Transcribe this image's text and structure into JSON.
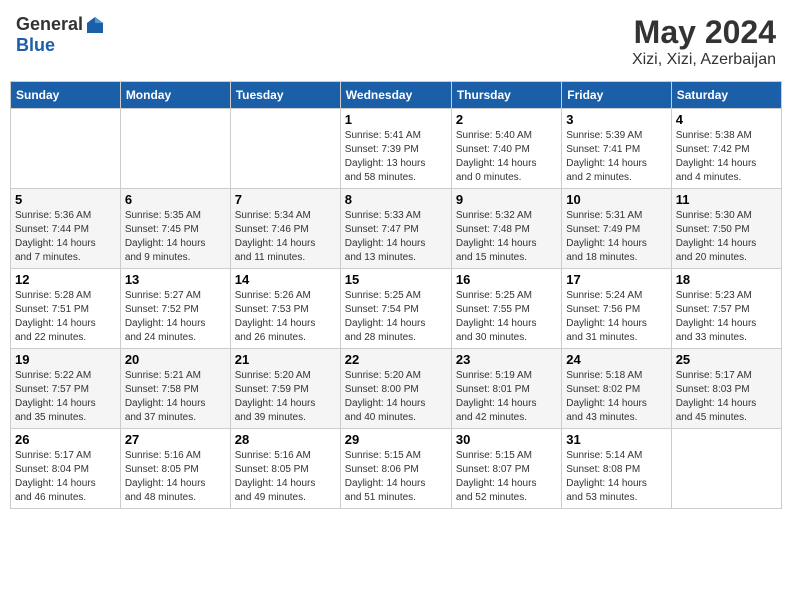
{
  "header": {
    "logo_general": "General",
    "logo_blue": "Blue",
    "month_title": "May 2024",
    "location": "Xizi, Xizi, Azerbaijan"
  },
  "weekdays": [
    "Sunday",
    "Monday",
    "Tuesday",
    "Wednesday",
    "Thursday",
    "Friday",
    "Saturday"
  ],
  "weeks": [
    [
      {
        "day": "",
        "info": ""
      },
      {
        "day": "",
        "info": ""
      },
      {
        "day": "",
        "info": ""
      },
      {
        "day": "1",
        "info": "Sunrise: 5:41 AM\nSunset: 7:39 PM\nDaylight: 13 hours\nand 58 minutes."
      },
      {
        "day": "2",
        "info": "Sunrise: 5:40 AM\nSunset: 7:40 PM\nDaylight: 14 hours\nand 0 minutes."
      },
      {
        "day": "3",
        "info": "Sunrise: 5:39 AM\nSunset: 7:41 PM\nDaylight: 14 hours\nand 2 minutes."
      },
      {
        "day": "4",
        "info": "Sunrise: 5:38 AM\nSunset: 7:42 PM\nDaylight: 14 hours\nand 4 minutes."
      }
    ],
    [
      {
        "day": "5",
        "info": "Sunrise: 5:36 AM\nSunset: 7:44 PM\nDaylight: 14 hours\nand 7 minutes."
      },
      {
        "day": "6",
        "info": "Sunrise: 5:35 AM\nSunset: 7:45 PM\nDaylight: 14 hours\nand 9 minutes."
      },
      {
        "day": "7",
        "info": "Sunrise: 5:34 AM\nSunset: 7:46 PM\nDaylight: 14 hours\nand 11 minutes."
      },
      {
        "day": "8",
        "info": "Sunrise: 5:33 AM\nSunset: 7:47 PM\nDaylight: 14 hours\nand 13 minutes."
      },
      {
        "day": "9",
        "info": "Sunrise: 5:32 AM\nSunset: 7:48 PM\nDaylight: 14 hours\nand 15 minutes."
      },
      {
        "day": "10",
        "info": "Sunrise: 5:31 AM\nSunset: 7:49 PM\nDaylight: 14 hours\nand 18 minutes."
      },
      {
        "day": "11",
        "info": "Sunrise: 5:30 AM\nSunset: 7:50 PM\nDaylight: 14 hours\nand 20 minutes."
      }
    ],
    [
      {
        "day": "12",
        "info": "Sunrise: 5:28 AM\nSunset: 7:51 PM\nDaylight: 14 hours\nand 22 minutes."
      },
      {
        "day": "13",
        "info": "Sunrise: 5:27 AM\nSunset: 7:52 PM\nDaylight: 14 hours\nand 24 minutes."
      },
      {
        "day": "14",
        "info": "Sunrise: 5:26 AM\nSunset: 7:53 PM\nDaylight: 14 hours\nand 26 minutes."
      },
      {
        "day": "15",
        "info": "Sunrise: 5:25 AM\nSunset: 7:54 PM\nDaylight: 14 hours\nand 28 minutes."
      },
      {
        "day": "16",
        "info": "Sunrise: 5:25 AM\nSunset: 7:55 PM\nDaylight: 14 hours\nand 30 minutes."
      },
      {
        "day": "17",
        "info": "Sunrise: 5:24 AM\nSunset: 7:56 PM\nDaylight: 14 hours\nand 31 minutes."
      },
      {
        "day": "18",
        "info": "Sunrise: 5:23 AM\nSunset: 7:57 PM\nDaylight: 14 hours\nand 33 minutes."
      }
    ],
    [
      {
        "day": "19",
        "info": "Sunrise: 5:22 AM\nSunset: 7:57 PM\nDaylight: 14 hours\nand 35 minutes."
      },
      {
        "day": "20",
        "info": "Sunrise: 5:21 AM\nSunset: 7:58 PM\nDaylight: 14 hours\nand 37 minutes."
      },
      {
        "day": "21",
        "info": "Sunrise: 5:20 AM\nSunset: 7:59 PM\nDaylight: 14 hours\nand 39 minutes."
      },
      {
        "day": "22",
        "info": "Sunrise: 5:20 AM\nSunset: 8:00 PM\nDaylight: 14 hours\nand 40 minutes."
      },
      {
        "day": "23",
        "info": "Sunrise: 5:19 AM\nSunset: 8:01 PM\nDaylight: 14 hours\nand 42 minutes."
      },
      {
        "day": "24",
        "info": "Sunrise: 5:18 AM\nSunset: 8:02 PM\nDaylight: 14 hours\nand 43 minutes."
      },
      {
        "day": "25",
        "info": "Sunrise: 5:17 AM\nSunset: 8:03 PM\nDaylight: 14 hours\nand 45 minutes."
      }
    ],
    [
      {
        "day": "26",
        "info": "Sunrise: 5:17 AM\nSunset: 8:04 PM\nDaylight: 14 hours\nand 46 minutes."
      },
      {
        "day": "27",
        "info": "Sunrise: 5:16 AM\nSunset: 8:05 PM\nDaylight: 14 hours\nand 48 minutes."
      },
      {
        "day": "28",
        "info": "Sunrise: 5:16 AM\nSunset: 8:05 PM\nDaylight: 14 hours\nand 49 minutes."
      },
      {
        "day": "29",
        "info": "Sunrise: 5:15 AM\nSunset: 8:06 PM\nDaylight: 14 hours\nand 51 minutes."
      },
      {
        "day": "30",
        "info": "Sunrise: 5:15 AM\nSunset: 8:07 PM\nDaylight: 14 hours\nand 52 minutes."
      },
      {
        "day": "31",
        "info": "Sunrise: 5:14 AM\nSunset: 8:08 PM\nDaylight: 14 hours\nand 53 minutes."
      },
      {
        "day": "",
        "info": ""
      }
    ]
  ]
}
